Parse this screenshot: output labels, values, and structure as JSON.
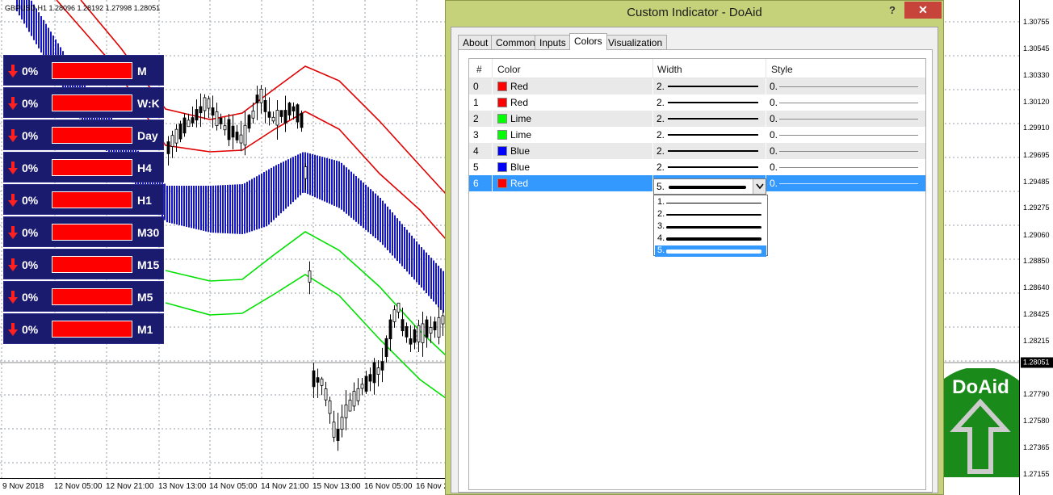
{
  "chart": {
    "info": "GBPUSD,H1  1.28096 1.28192 1.27998 1.28051",
    "price_labels": [
      "1.30755",
      "1.30545",
      "1.30330",
      "1.30120",
      "1.29910",
      "1.29695",
      "1.29485",
      "1.29275",
      "1.29060",
      "1.28850",
      "1.28640",
      "1.28425",
      "1.28215",
      "1.27790",
      "1.27580",
      "1.27365",
      "1.27155"
    ],
    "current_price": "1.28051",
    "time_labels": [
      "9 Nov 2018",
      "12 Nov 05:00",
      "12 Nov 21:00",
      "13 Nov 13:00",
      "14 Nov 05:00",
      "14 Nov 21:00",
      "15 Nov 13:00",
      "16 Nov 05:00",
      "16 Nov 2"
    ],
    "colors": {
      "upper_band": "#e00000",
      "lower_band": "#00e000",
      "cloud": "#1515c8",
      "grid": "#9aa0a8"
    }
  },
  "trend_panel": {
    "rows": [
      {
        "pct": "0%",
        "tf": "M"
      },
      {
        "pct": "0%",
        "tf": "W:K"
      },
      {
        "pct": "0%",
        "tf": "Day"
      },
      {
        "pct": "0%",
        "tf": "H4"
      },
      {
        "pct": "0%",
        "tf": "H1"
      },
      {
        "pct": "0%",
        "tf": "M30"
      },
      {
        "pct": "0%",
        "tf": "M15"
      },
      {
        "pct": "0%",
        "tf": "M5"
      },
      {
        "pct": "0%",
        "tf": "M1"
      }
    ],
    "arrow_icon": "down-arrow-icon",
    "bar_color": "#ff0000"
  },
  "dialog": {
    "title": "Custom Indicator - DoAid",
    "help": "?",
    "close": "✕",
    "tabs": [
      "About",
      "Common",
      "Inputs",
      "Colors",
      "Visualization"
    ],
    "active_tab": "Colors",
    "columns": [
      "#",
      "Color",
      "Width",
      "Style"
    ],
    "rows": [
      {
        "index": "0",
        "color_name": "Red",
        "color": "#ff0000",
        "width": "2.",
        "style": "0."
      },
      {
        "index": "1",
        "color_name": "Red",
        "color": "#ff0000",
        "width": "2.",
        "style": "0."
      },
      {
        "index": "2",
        "color_name": "Lime",
        "color": "#00ff00",
        "width": "2.",
        "style": "0."
      },
      {
        "index": "3",
        "color_name": "Lime",
        "color": "#00ff00",
        "width": "2.",
        "style": "0."
      },
      {
        "index": "4",
        "color_name": "Blue",
        "color": "#0000ff",
        "width": "2.",
        "style": "0."
      },
      {
        "index": "5",
        "color_name": "Blue",
        "color": "#0000ff",
        "width": "2.",
        "style": "0."
      },
      {
        "index": "6",
        "color_name": "Red",
        "color": "#ff0000",
        "width": "5.",
        "style": "0."
      }
    ],
    "selected_row": "6",
    "width_options": [
      "1.",
      "2.",
      "3.",
      "4.",
      "5."
    ],
    "selected_width": "5."
  },
  "logo": {
    "text": "DoAid",
    "color": "#1a8a1a"
  }
}
